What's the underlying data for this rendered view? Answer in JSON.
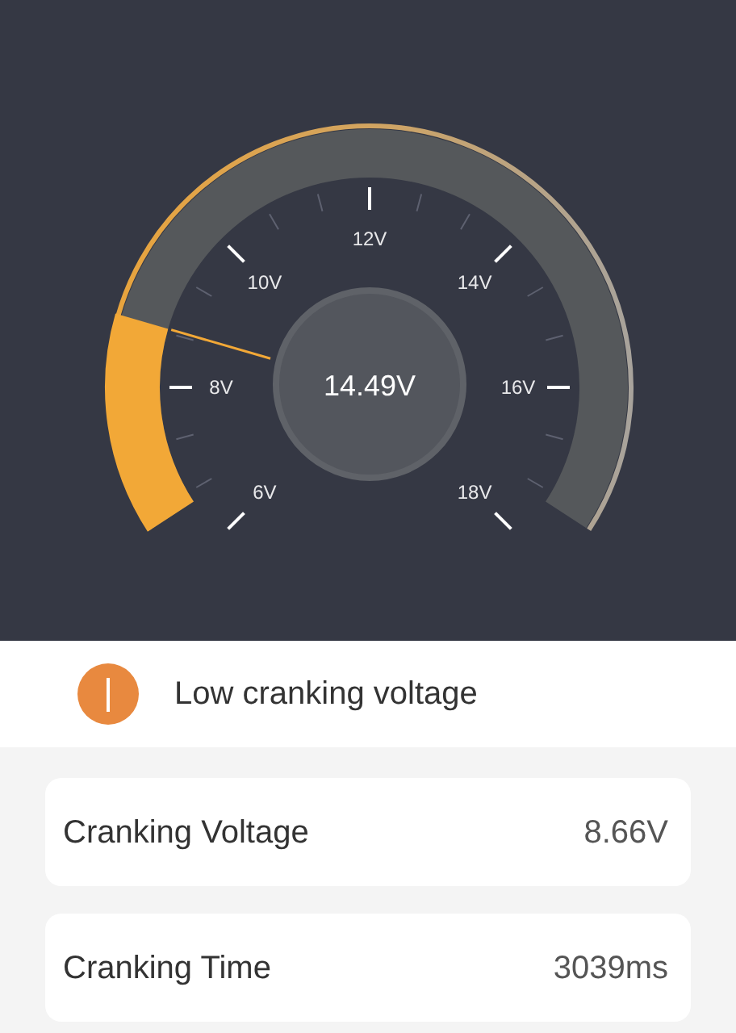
{
  "gauge": {
    "reading": "14.49V",
    "scale_labels": [
      "6V",
      "8V",
      "10V",
      "12V",
      "14V",
      "16V",
      "18V"
    ]
  },
  "alert": {
    "kind": "info",
    "text": "Low cranking voltage"
  },
  "metrics": [
    {
      "label": "Cranking Voltage",
      "value": "8.66V"
    },
    {
      "label": "Cranking Time",
      "value": "3039ms"
    }
  ]
}
